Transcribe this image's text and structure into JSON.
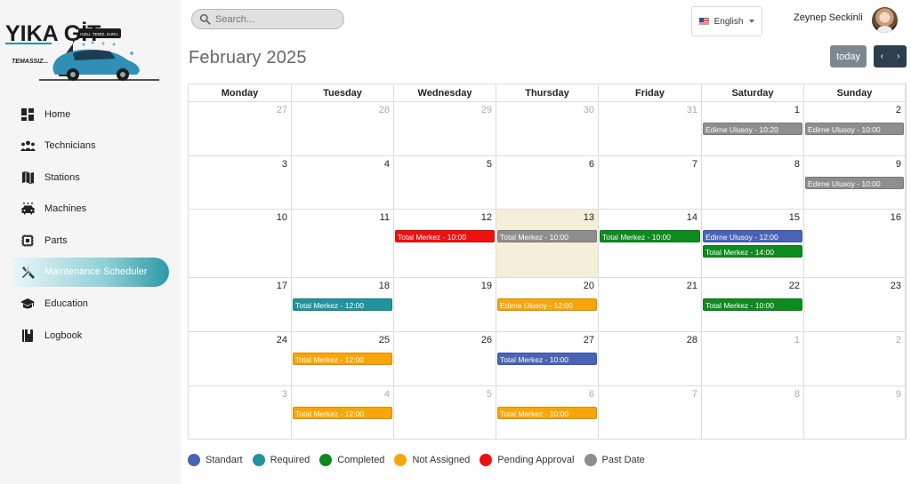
{
  "brand": {
    "name": "YIKA GİT",
    "tagline": "HIZLI. TEMİZ. KURU.",
    "sub": "TEMASSIZ..."
  },
  "search": {
    "placeholder": "Search..."
  },
  "language": {
    "selected": "English"
  },
  "user": {
    "name": "Zeynep Seckinli"
  },
  "nav": [
    {
      "label": "Home",
      "icon": "dashboard-icon",
      "active": false
    },
    {
      "label": "Technicians",
      "icon": "group-icon",
      "active": false
    },
    {
      "label": "Stations",
      "icon": "map-icon",
      "active": false
    },
    {
      "label": "Machines",
      "icon": "car-wash-icon",
      "active": false
    },
    {
      "label": "Parts",
      "icon": "chip-icon",
      "active": false
    },
    {
      "label": "Maintenance Scheduler",
      "icon": "tools-icon",
      "active": true
    },
    {
      "label": "Education",
      "icon": "graduation-cap-icon",
      "active": false
    },
    {
      "label": "Logbook",
      "icon": "book-icon",
      "active": false
    }
  ],
  "calendar": {
    "title": "February 2025",
    "today_label": "today",
    "prev_label": "‹",
    "next_label": "›",
    "weekdays": [
      "Monday",
      "Tuesday",
      "Wednesday",
      "Thursday",
      "Friday",
      "Saturday",
      "Sunday"
    ],
    "weeks": [
      [
        {
          "d": "27",
          "other": true
        },
        {
          "d": "28",
          "other": true
        },
        {
          "d": "29",
          "other": true
        },
        {
          "d": "30",
          "other": true
        },
        {
          "d": "31",
          "other": true
        },
        {
          "d": "1"
        },
        {
          "d": "2"
        }
      ],
      [
        {
          "d": "3"
        },
        {
          "d": "4"
        },
        {
          "d": "5"
        },
        {
          "d": "6"
        },
        {
          "d": "7"
        },
        {
          "d": "8"
        },
        {
          "d": "9"
        }
      ],
      [
        {
          "d": "10"
        },
        {
          "d": "11"
        },
        {
          "d": "12"
        },
        {
          "d": "13",
          "today": true
        },
        {
          "d": "14"
        },
        {
          "d": "15"
        },
        {
          "d": "16"
        }
      ],
      [
        {
          "d": "17"
        },
        {
          "d": "18"
        },
        {
          "d": "19"
        },
        {
          "d": "20"
        },
        {
          "d": "21"
        },
        {
          "d": "22"
        },
        {
          "d": "23"
        }
      ],
      [
        {
          "d": "24"
        },
        {
          "d": "25"
        },
        {
          "d": "26"
        },
        {
          "d": "27"
        },
        {
          "d": "28"
        },
        {
          "d": "1",
          "other": true
        },
        {
          "d": "2",
          "other": true
        }
      ],
      [
        {
          "d": "3",
          "other": true
        },
        {
          "d": "4",
          "other": true
        },
        {
          "d": "5",
          "other": true
        },
        {
          "d": "6",
          "other": true
        },
        {
          "d": "7",
          "other": true
        },
        {
          "d": "8",
          "other": true
        },
        {
          "d": "9",
          "other": true
        }
      ]
    ],
    "events": [
      {
        "week": 0,
        "day": 5,
        "slot": 0,
        "label": "Edirne Ulusoy - 10:20",
        "status": "past"
      },
      {
        "week": 0,
        "day": 6,
        "slot": 0,
        "label": "Edirne Ulusoy - 10:00",
        "status": "past"
      },
      {
        "week": 1,
        "day": 6,
        "slot": 0,
        "label": "Edirne Ulusoy - 10:00",
        "status": "past"
      },
      {
        "week": 2,
        "day": 2,
        "slot": 0,
        "label": "Total Merkez - 10:00",
        "status": "pending"
      },
      {
        "week": 2,
        "day": 3,
        "slot": 0,
        "label": "Total Merkez - 10:00",
        "status": "past"
      },
      {
        "week": 2,
        "day": 4,
        "slot": 0,
        "label": "Total Merkez - 10:00",
        "status": "completed"
      },
      {
        "week": 2,
        "day": 5,
        "slot": 0,
        "label": "Edirne Ulusoy - 12:00",
        "status": "standart"
      },
      {
        "week": 2,
        "day": 5,
        "slot": 1,
        "label": "Total Merkez - 14:00",
        "status": "completed"
      },
      {
        "week": 3,
        "day": 1,
        "slot": 0,
        "label": "Total Merkez - 12:00",
        "status": "required"
      },
      {
        "week": 3,
        "day": 3,
        "slot": 0,
        "label": "Edirne Ulusoy - 12:00",
        "status": "not_assigned"
      },
      {
        "week": 3,
        "day": 5,
        "slot": 0,
        "label": "Total Merkez - 10:00",
        "status": "completed"
      },
      {
        "week": 4,
        "day": 1,
        "slot": 0,
        "label": "Total Merkez - 12:00",
        "status": "not_assigned"
      },
      {
        "week": 4,
        "day": 3,
        "slot": 0,
        "label": "Total Merkez - 10:00",
        "status": "standart"
      },
      {
        "week": 5,
        "day": 1,
        "slot": 0,
        "label": "Total Merkez - 12:00",
        "status": "not_assigned"
      },
      {
        "week": 5,
        "day": 3,
        "slot": 0,
        "label": "Total Merkez - 10:00",
        "status": "not_assigned"
      }
    ]
  },
  "status_colors": {
    "standart": "#4a63b5",
    "required": "#21939e",
    "completed": "#0f8a1f",
    "not_assigned": "#f7a60a",
    "pending": "#ee1111",
    "past": "#8e8e8e"
  },
  "legend": [
    {
      "key": "standart",
      "label": "Standart"
    },
    {
      "key": "required",
      "label": "Required"
    },
    {
      "key": "completed",
      "label": "Completed"
    },
    {
      "key": "not_assigned",
      "label": "Not Assigned"
    },
    {
      "key": "pending",
      "label": "Pending Approval"
    },
    {
      "key": "past",
      "label": "Past Date"
    }
  ]
}
